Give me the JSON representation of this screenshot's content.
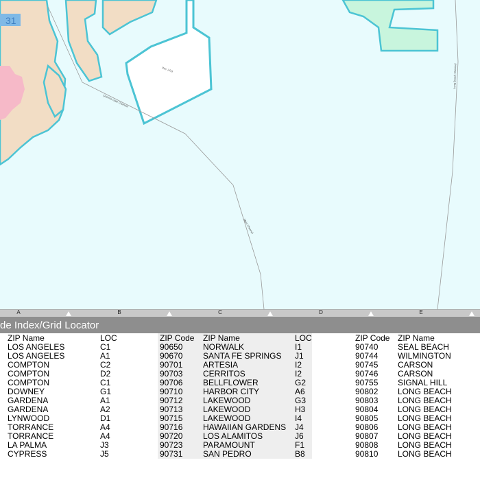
{
  "map": {
    "grid_columns": [
      "A",
      "B",
      "C",
      "D",
      "E"
    ],
    "colors": {
      "water": "#e8fbfd",
      "land": "#f2ddc5",
      "coast": "#4cc4d4",
      "urban_pink": "#f6b9c8",
      "park_green": "#c8f5dd",
      "channel_line": "#9a9a9a"
    },
    "route_number": "31",
    "channel_label_1": "Queens Gate Channel",
    "channel_label_2": "Main Channel",
    "channel_label_3": "Long Beach Channel",
    "pier_label": "Pier J Rd"
  },
  "index": {
    "title": "de Index/Grid Locator",
    "headers": {
      "zip_name": "ZIP Name",
      "loc": "LOC",
      "zip_code": "ZIP Code"
    },
    "rows": [
      [
        "LOS ANGELES",
        "C1",
        "90650",
        "NORWALK",
        "I1",
        "90740",
        "SEAL BEACH"
      ],
      [
        "LOS ANGELES",
        "A1",
        "90670",
        "SANTA FE SPRINGS",
        "J1",
        "90744",
        "WILMINGTON"
      ],
      [
        "COMPTON",
        "C2",
        "90701",
        "ARTESIA",
        "I2",
        "90745",
        "CARSON"
      ],
      [
        "COMPTON",
        "D2",
        "90703",
        "CERRITOS",
        "I2",
        "90746",
        "CARSON"
      ],
      [
        "COMPTON",
        "C1",
        "90706",
        "BELLFLOWER",
        "G2",
        "90755",
        "SIGNAL HILL"
      ],
      [
        "DOWNEY",
        "G1",
        "90710",
        "HARBOR CITY",
        "A6",
        "90802",
        "LONG BEACH"
      ],
      [
        "GARDENA",
        "A1",
        "90712",
        "LAKEWOOD",
        "G3",
        "90803",
        "LONG BEACH"
      ],
      [
        "GARDENA",
        "A2",
        "90713",
        "LAKEWOOD",
        "H3",
        "90804",
        "LONG BEACH"
      ],
      [
        "LYNWOOD",
        "D1",
        "90715",
        "LAKEWOOD",
        "I4",
        "90805",
        "LONG BEACH"
      ],
      [
        "TORRANCE",
        "A4",
        "90716",
        "HAWAIIAN GARDENS",
        "J4",
        "90806",
        "LONG BEACH"
      ],
      [
        "TORRANCE",
        "A4",
        "90720",
        "LOS ALAMITOS",
        "J6",
        "90807",
        "LONG BEACH"
      ],
      [
        "LA PALMA",
        "J3",
        "90723",
        "PARAMOUNT",
        "F1",
        "90808",
        "LONG BEACH"
      ],
      [
        "CYPRESS",
        "J5",
        "90731",
        "SAN PEDRO",
        "B8",
        "90810",
        "LONG BEACH"
      ]
    ]
  }
}
